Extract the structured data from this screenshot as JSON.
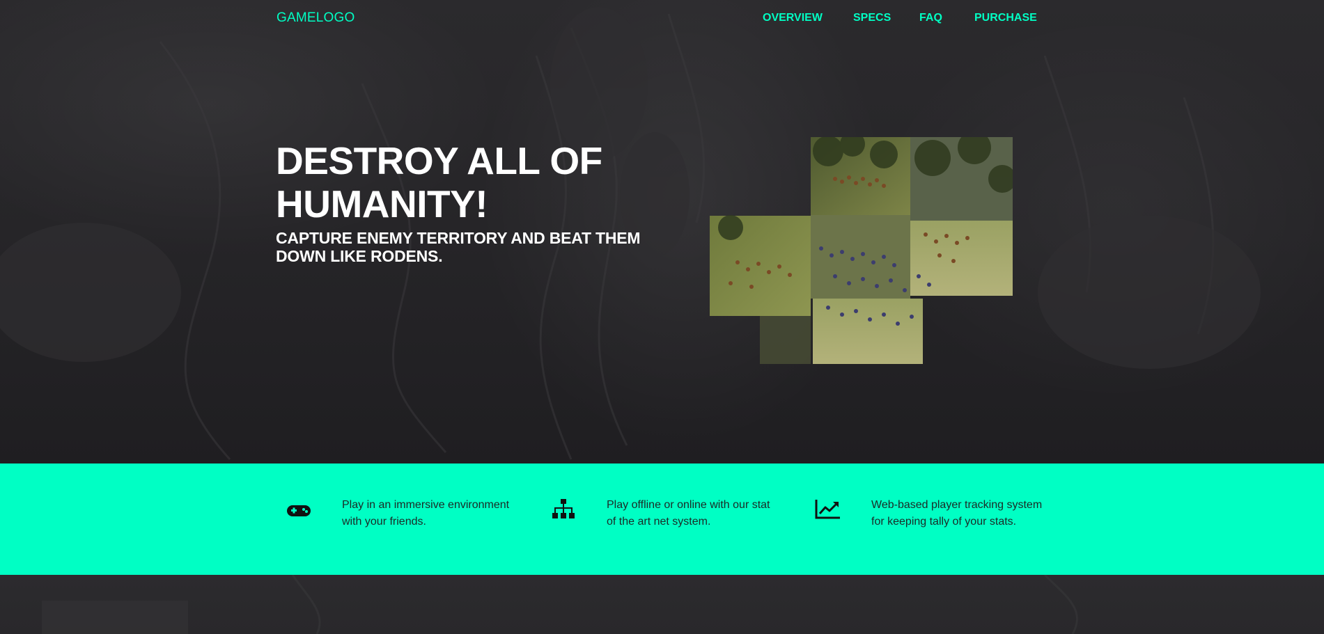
{
  "nav": {
    "logo": "GAMELOGO",
    "links": [
      "OVERVIEW",
      "SPECS",
      "FAQ",
      "PURCHASE"
    ]
  },
  "hero": {
    "headline_line1": "DESTROY ALL OF",
    "headline_line2": "HUMANITY!",
    "subhead_line1": "CAPTURE ENEMY TERRITORY AND BEAT THEM",
    "subhead_line2": "DOWN LIKE RODENS."
  },
  "features": [
    {
      "icon": "gamepad-icon",
      "line1": "Play in an immersive environment",
      "line2": "with your friends."
    },
    {
      "icon": "network-icon",
      "line1": "Play offline or online with our stat",
      "line2": "of the art net system."
    },
    {
      "icon": "trending-up-icon",
      "line1": "Web-based player tracking system",
      "line2": "for keeping tally of your stats."
    }
  ],
  "colors": {
    "accent": "#00ffc4",
    "background": "#242326",
    "text_light": "#ffffff",
    "text_dark": "#1b2a26"
  }
}
